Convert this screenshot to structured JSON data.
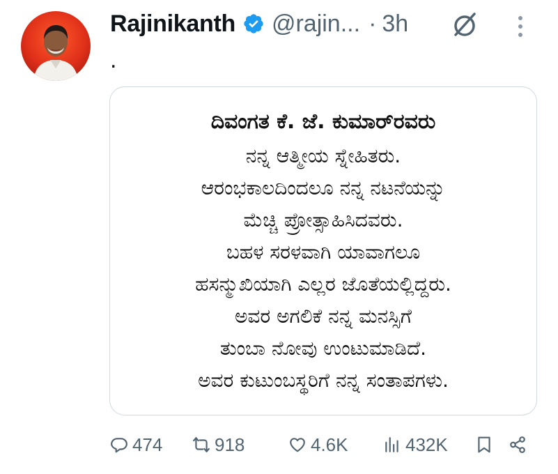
{
  "author": {
    "name": "Rajinikanth",
    "handle": "@rajin...",
    "separator": "·",
    "time": "3h",
    "verified": true,
    "avatar_icon": "profile-photo"
  },
  "tweet": {
    "text": "."
  },
  "media": {
    "title": "ದಿವಂಗತ ಕೆ. ಜೆ. ಕುಮಾರ್‌ರವರು",
    "lines": [
      "ನನ್ನ ಆತ್ಮೀಯ ಸ್ನೇಹಿತರು.",
      "ಆರಂಭಕಾಲದಿಂದಲೂ ನನ್ನ ನಟನೆಯನ್ನು",
      "ಮೆಚ್ಚಿ ಪ್ರೋತ್ಸಾಹಿಸಿದವರು.",
      "ಬಹಳ ಸರಳವಾಗಿ ಯಾವಾಗಲೂ",
      "ಹಸನ್ಮುಖಿಯಾಗಿ ಎಲ್ಲರ ಜೊತೆಯಲ್ಲಿದ್ದರು.",
      "ಅವರ ಅಗಲಿಕೆ ನನ್ನ ಮನಸ್ಸಿಗೆ",
      "ತುಂಬಾ ನೋವು ಉಂಟುಮಾಡಿದೆ.",
      "ಅವರ ಕುಟುಂಬಸ್ಥರಿಗೆ ನನ್ನ ಸಂತಾಪಗಳು."
    ]
  },
  "actions": {
    "replies": "474",
    "reposts": "918",
    "likes": "4.6K",
    "views": "432K"
  },
  "colors": {
    "text_primary": "#0f1419",
    "text_secondary": "#536471",
    "verified_blue": "#1d9bf0",
    "border": "#cfd9de"
  },
  "icons": [
    "verified-badge-icon",
    "grok-icon",
    "more-icon",
    "reply-icon",
    "repost-icon",
    "like-icon",
    "views-icon",
    "bookmark-icon",
    "share-icon"
  ]
}
